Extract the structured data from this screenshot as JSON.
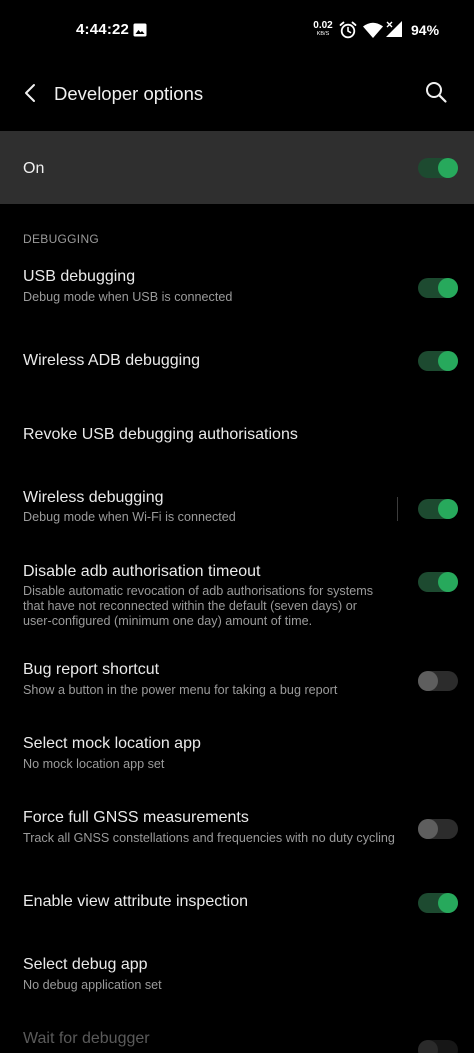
{
  "status_bar": {
    "time": "4:44:22",
    "net_speed_value": "0.02",
    "net_speed_unit": "KB/S",
    "battery": "94%"
  },
  "app_bar": {
    "title": "Developer options"
  },
  "master_switch": {
    "label": "On",
    "checked": true
  },
  "section": {
    "title": "DEBUGGING"
  },
  "items": [
    {
      "title": "USB debugging",
      "subtitle": "Debug mode when USB is connected",
      "toggle": "on"
    },
    {
      "title": "Wireless ADB debugging",
      "subtitle": "",
      "toggle": "on"
    },
    {
      "title": "Revoke USB debugging authorisations",
      "subtitle": "",
      "toggle": "none"
    },
    {
      "title": "Wireless debugging",
      "subtitle": "Debug mode when Wi-Fi is connected",
      "toggle": "on"
    },
    {
      "title": "Disable adb authorisation timeout",
      "subtitle_lines": [
        "Disable automatic revocation of adb authorisations for systems",
        "that have not reconnected within the default (seven days) or",
        "user-configured (minimum one day) amount of time."
      ],
      "toggle": "on"
    },
    {
      "title": "Bug report shortcut",
      "subtitle": "Show a button in the power menu for taking a bug report",
      "toggle": "off"
    },
    {
      "title": "Select mock location app",
      "subtitle": "No mock location app set",
      "toggle": "none"
    },
    {
      "title": "Force full GNSS measurements",
      "subtitle": "Track all GNSS constellations and frequencies with no duty cycling",
      "toggle": "off"
    },
    {
      "title": "Enable view attribute inspection",
      "subtitle": "",
      "toggle": "on"
    },
    {
      "title": "Select debug app",
      "subtitle": "No debug application set",
      "toggle": "none"
    },
    {
      "title": "Wait for debugger",
      "subtitle": "",
      "toggle": "disabled"
    }
  ],
  "colors": {
    "accent": "#27a95c",
    "accent_track": "#1d4a30",
    "background": "#000000",
    "master_row": "#2f2f2f"
  },
  "icons": [
    "image-icon",
    "alarm-icon",
    "wifi-icon",
    "cellular-signal-icon",
    "back-arrow-icon",
    "search-icon"
  ]
}
